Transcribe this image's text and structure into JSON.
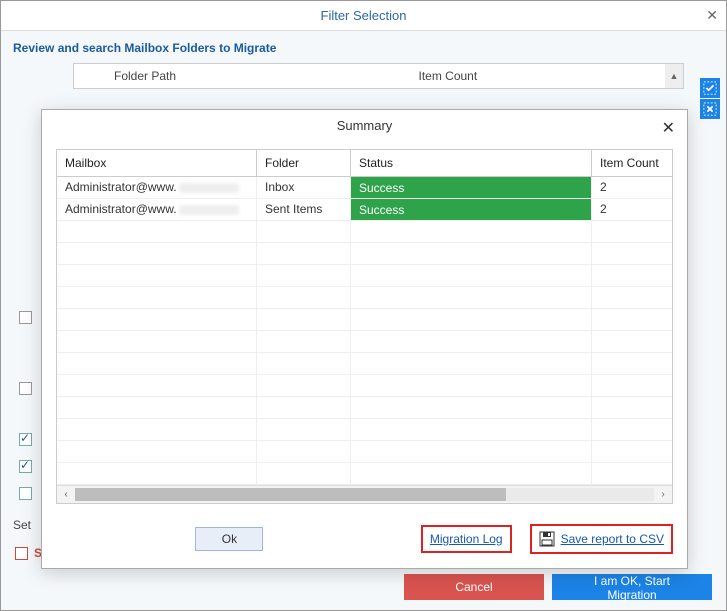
{
  "window": {
    "title": "Filter Selection",
    "section_title": "Review and search Mailbox Folders to Migrate"
  },
  "back_table": {
    "col_path": "Folder Path",
    "col_count": "Item Count"
  },
  "left_checks": {
    "plain": [
      false,
      false
    ],
    "checked": [
      true,
      true,
      false
    ]
  },
  "set_label": "Set",
  "skip": {
    "label": "Skip Previously Migrated Items ( Incremental )"
  },
  "footer": {
    "cancel": "Cancel",
    "start": "I am OK, Start Migration"
  },
  "modal": {
    "title": "Summary",
    "columns": {
      "mailbox": "Mailbox",
      "folder": "Folder",
      "status": "Status",
      "item_count": "Item Count"
    },
    "rows": [
      {
        "mailbox_prefix": "Administrator@www",
        "folder": "Inbox",
        "status": "Success",
        "item_count": "2"
      },
      {
        "mailbox_prefix": "Administrator@www",
        "folder": "Sent Items",
        "status": "Success",
        "item_count": "2"
      }
    ],
    "ok": "Ok",
    "migration_log": "Migration Log",
    "save_csv": "Save report to CSV"
  }
}
